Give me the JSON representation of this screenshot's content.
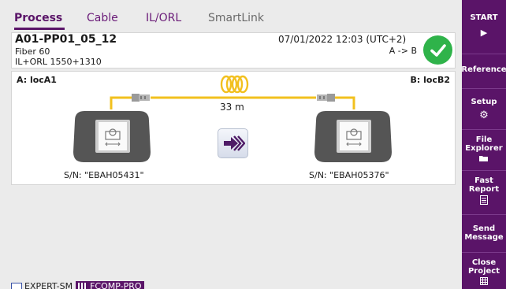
{
  "tabs": [
    {
      "label": "Process"
    },
    {
      "label": "Cable"
    },
    {
      "label": "IL/ORL"
    },
    {
      "label": "SmartLink"
    }
  ],
  "info": {
    "cable_id": "A01-PP01_05_12",
    "fiber": "Fiber 60",
    "wavelengths": "IL+ORL 1550+1310",
    "datetime": "07/01/2022 12:03 (UTC+2)",
    "direction": "A -> B",
    "status_color": "#2fb34a"
  },
  "diagram": {
    "loc_a": "A: locA1",
    "loc_b": "B: locB2",
    "length": "33 m",
    "serial_a": "S/N: \"EBAH05431\"",
    "serial_b": "S/N: \"EBAH05376\"",
    "fiber_color": "#f2c01e"
  },
  "status_bar": {
    "item1": "EXPERT-SM",
    "item2": "FCOMP-PRO"
  },
  "sidebar": {
    "start": "START",
    "reference": "Reference",
    "setup": "Setup",
    "file_explorer_1": "File",
    "file_explorer_2": "Explorer",
    "fast_report_1": "Fast",
    "fast_report_2": "Report",
    "send_message_1": "Send",
    "send_message_2": "Message",
    "close_project_1": "Close",
    "close_project_2": "Project"
  },
  "colors": {
    "accent": "#5a1468",
    "background": "#ebebeb"
  }
}
